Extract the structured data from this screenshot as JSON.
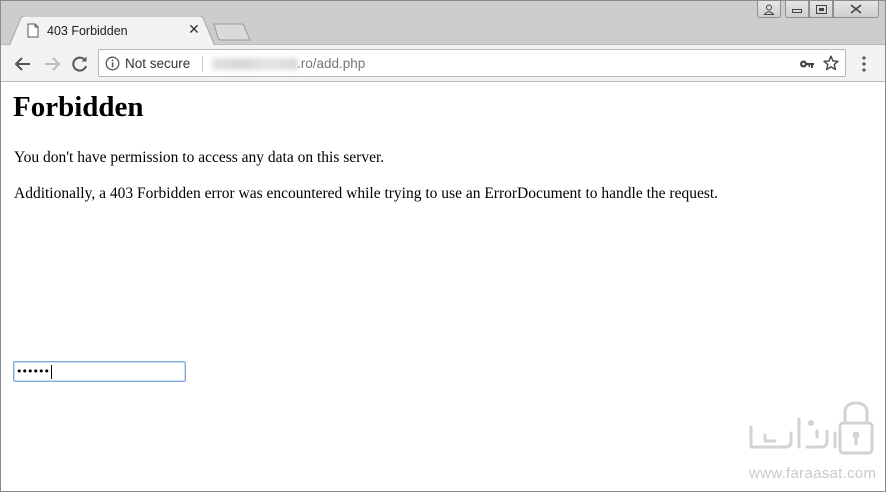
{
  "tab": {
    "title": "403 Forbidden",
    "close_glyph": "✕",
    "favicon": "page-icon"
  },
  "window_controls": {
    "user": "user-icon",
    "minimize": "minimize-icon",
    "maximize": "maximize-icon",
    "close": "close-icon"
  },
  "toolbar": {
    "back": "back-arrow-icon",
    "forward": "forward-arrow-icon",
    "reload": "reload-icon",
    "security_label": "Not secure",
    "url_visible": ".ro/add.php",
    "key": "key-icon",
    "bookmark": "star-icon",
    "menu": "kebab-menu-icon"
  },
  "page": {
    "heading": "Forbidden",
    "paragraph1": "You don't have permission to access any data on this server.",
    "paragraph2": "Additionally, a 403 Forbidden error was encountered while trying to use an ErrorDocument to handle the request.",
    "password_value": "••••••"
  },
  "watermark": {
    "url": "www.faraasat.com"
  },
  "colors": {
    "tabstrip": "#cdcdcd",
    "toolbar": "#f2f2f2",
    "input_focus": "#7fa8dd",
    "watermark": "#c9c9c9"
  }
}
